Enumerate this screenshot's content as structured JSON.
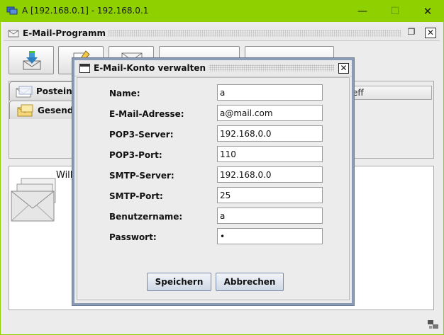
{
  "window": {
    "title": "A [192.168.0.1] - 192.168.0.1",
    "minimize_glyph": "—",
    "maximize_glyph": "☐",
    "close_glyph": "✕"
  },
  "frame": {
    "title": "E-Mail-Programm",
    "restore_glyph": "❐",
    "close_glyph": "✕"
  },
  "tabs": [
    {
      "label": "Posteinga",
      "icon": "inbox-envelope-icon"
    },
    {
      "label": "Gesende",
      "icon": "sent-envelope-icon"
    }
  ],
  "table": {
    "partial_header": "eff"
  },
  "welcome_text": "Will",
  "dialog": {
    "title": "E-Mail-Konto verwalten",
    "close_glyph": "✕",
    "fields": [
      {
        "label": "Name:",
        "value": "a"
      },
      {
        "label": "E-Mail-Adresse:",
        "value": "a@mail.com"
      },
      {
        "label": "POP3-Server:",
        "value": "192.168.0.0"
      },
      {
        "label": "POP3-Port:",
        "value": "110"
      },
      {
        "label": "SMTP-Server:",
        "value": "192.168.0.0"
      },
      {
        "label": "SMTP-Port:",
        "value": "25"
      },
      {
        "label": "Benutzername:",
        "value": "a"
      },
      {
        "label": "Passwort:",
        "value": "•"
      }
    ],
    "save_label": "Speichern",
    "cancel_label": "Abbrechen"
  },
  "colors": {
    "titlebar": "#8fd000",
    "dialog_border": "#8b9bb6",
    "button_gradient_bottom": "#cfd8e6"
  }
}
